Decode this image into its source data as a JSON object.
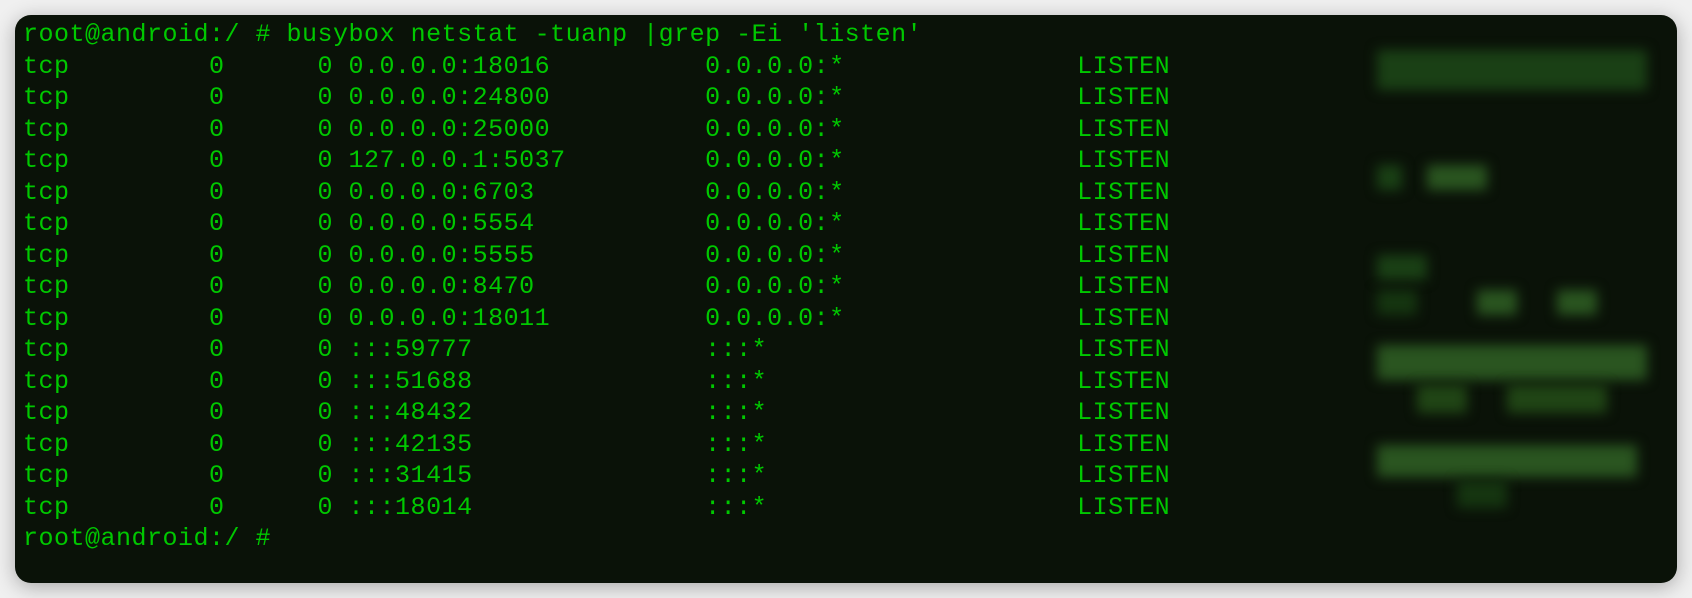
{
  "command_line1": {
    "prompt": "root@android:/ #",
    "command": " busybox netstat -tuanp |grep -Ei 'listen'"
  },
  "netstat_rows": [
    {
      "proto": "tcp",
      "recvq": "0",
      "sendq": "0",
      "local": "0.0.0.0:18016",
      "foreign": "0.0.0.0:*",
      "state": "LISTEN"
    },
    {
      "proto": "tcp",
      "recvq": "0",
      "sendq": "0",
      "local": "0.0.0.0:24800",
      "foreign": "0.0.0.0:*",
      "state": "LISTEN"
    },
    {
      "proto": "tcp",
      "recvq": "0",
      "sendq": "0",
      "local": "0.0.0.0:25000",
      "foreign": "0.0.0.0:*",
      "state": "LISTEN"
    },
    {
      "proto": "tcp",
      "recvq": "0",
      "sendq": "0",
      "local": "127.0.0.1:5037",
      "foreign": "0.0.0.0:*",
      "state": "LISTEN"
    },
    {
      "proto": "tcp",
      "recvq": "0",
      "sendq": "0",
      "local": "0.0.0.0:6703",
      "foreign": "0.0.0.0:*",
      "state": "LISTEN"
    },
    {
      "proto": "tcp",
      "recvq": "0",
      "sendq": "0",
      "local": "0.0.0.0:5554",
      "foreign": "0.0.0.0:*",
      "state": "LISTEN"
    },
    {
      "proto": "tcp",
      "recvq": "0",
      "sendq": "0",
      "local": "0.0.0.0:5555",
      "foreign": "0.0.0.0:*",
      "state": "LISTEN"
    },
    {
      "proto": "tcp",
      "recvq": "0",
      "sendq": "0",
      "local": "0.0.0.0:8470",
      "foreign": "0.0.0.0:*",
      "state": "LISTEN"
    },
    {
      "proto": "tcp",
      "recvq": "0",
      "sendq": "0",
      "local": "0.0.0.0:18011",
      "foreign": "0.0.0.0:*",
      "state": "LISTEN"
    },
    {
      "proto": "tcp",
      "recvq": "0",
      "sendq": "0",
      "local": ":::59777",
      "foreign": ":::*",
      "state": "LISTEN"
    },
    {
      "proto": "tcp",
      "recvq": "0",
      "sendq": "0",
      "local": ":::51688",
      "foreign": ":::*",
      "state": "LISTEN"
    },
    {
      "proto": "tcp",
      "recvq": "0",
      "sendq": "0",
      "local": ":::48432",
      "foreign": ":::*",
      "state": "LISTEN"
    },
    {
      "proto": "tcp",
      "recvq": "0",
      "sendq": "0",
      "local": ":::42135",
      "foreign": ":::*",
      "state": "LISTEN"
    },
    {
      "proto": "tcp",
      "recvq": "0",
      "sendq": "0",
      "local": ":::31415",
      "foreign": ":::*",
      "state": "LISTEN"
    },
    {
      "proto": "tcp",
      "recvq": "0",
      "sendq": "0",
      "local": ":::18014",
      "foreign": ":::*",
      "state": "LISTEN"
    }
  ],
  "command_line2": {
    "prompt": "root@android:/ #",
    "command": ""
  }
}
